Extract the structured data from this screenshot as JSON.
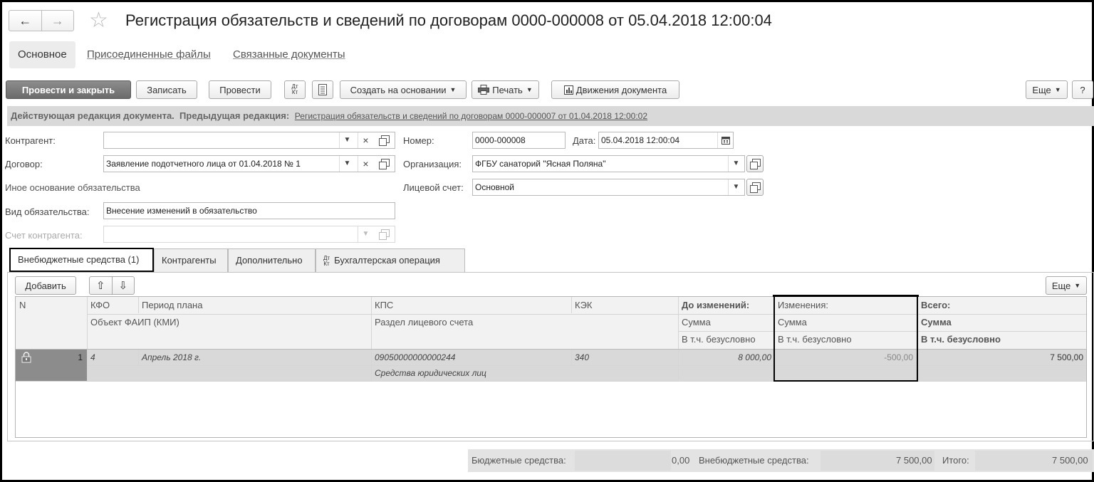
{
  "header": {
    "title": "Регистрация обязательств и сведений по договорам 0000-000008 от 05.04.2018 12:00:04"
  },
  "nav_tabs": [
    "Основное",
    "Присоединенные файлы",
    "Связанные документы"
  ],
  "toolbar": {
    "post_close": "Провести и закрыть",
    "save": "Записать",
    "post": "Провести",
    "dt": "Дт",
    "kt": "Кт",
    "create_basis": "Создать на основании",
    "print": "Печать",
    "movements": "Движения документа",
    "more": "Еще",
    "help": "?"
  },
  "info": {
    "current": "Действующая редакция документа.",
    "previous_label": "Предыдущая редакция:",
    "previous_link": "Регистрация обязательств и сведений по договорам 0000-000007 от 01.04.2018 12:00:02"
  },
  "form": {
    "counterparty_label": "Контрагент:",
    "counterparty_value": "",
    "contract_label": "Договор:",
    "contract_value": "Заявление подотчетного лица от 01.04.2018 № 1",
    "other_basis_label": "Иное основание обязательства",
    "obligation_type_label": "Вид обязательства:",
    "obligation_type_value": "Внесение изменений в обязательство",
    "counterparty_account_label": "Счет контрагента:",
    "number_label": "Номер:",
    "number_value": "0000-000008",
    "date_label": "Дата:",
    "date_value": "05.04.2018 12:00:04",
    "organization_label": "Организация:",
    "organization_value": "ФГБУ санаторий \"Ясная Поляна\"",
    "personal_account_label": "Лицевой счет:",
    "personal_account_value": "Основной"
  },
  "inner_tabs": [
    "Внебюджетные средства (1)",
    "Контрагенты",
    "Дополнительно",
    "Бухгалтерская операция"
  ],
  "table_toolbar": {
    "add": "Добавить",
    "more": "Еще"
  },
  "table": {
    "headers": {
      "n": "N",
      "kfo": "КФО",
      "period": "Период плана",
      "object": "Объект ФАИП (КМИ)",
      "kps": "КПС",
      "section": "Раздел лицевого счета",
      "kek": "КЭК",
      "before": "До изменений:",
      "before_sum": "Сумма",
      "before_uncond": "В т.ч. безусловно",
      "changes": "Изменения:",
      "changes_sum": "Сумма",
      "changes_uncond": "В т.ч. безусловно",
      "total": "Всего:",
      "total_sum": "Сумма",
      "total_uncond": "В т.ч. безусловно"
    },
    "rows": [
      {
        "n": "1",
        "kfo": "4",
        "period": "Апрель 2018 г.",
        "kps": "09050000000000244",
        "section": "Средства юридических лиц",
        "kek": "340",
        "before": "8 000,00",
        "changes": "-500,00",
        "total": "7 500,00"
      }
    ]
  },
  "footer": {
    "budget_label": "Бюджетные средства:",
    "budget_value": "0,00",
    "extra_label": "Внебюджетные средства:",
    "extra_value": "7 500,00",
    "total_label": "Итого:",
    "total_value": "7 500,00"
  }
}
